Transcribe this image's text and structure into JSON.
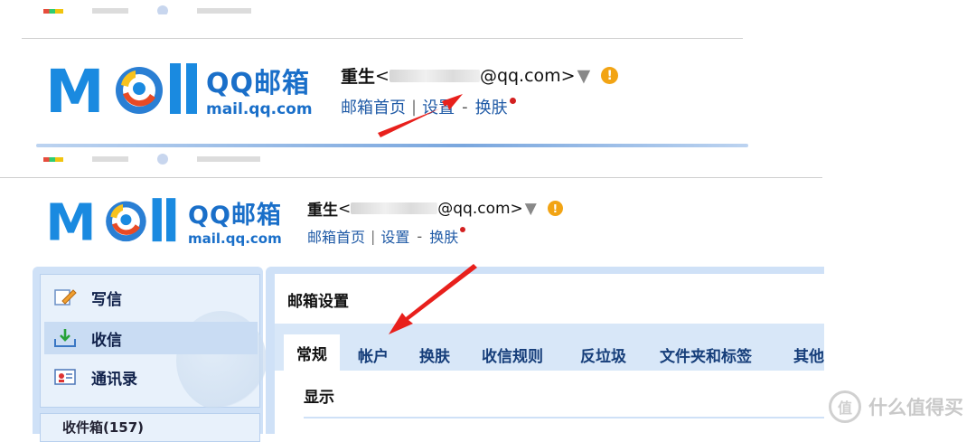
{
  "screens": [
    {
      "brand": {
        "cn": "QQ邮箱",
        "en": "mail.qq.com"
      },
      "user": {
        "name": "重生",
        "email_prefix": "<",
        "email_suffix": "@qq.com>",
        "caret": "▼",
        "warn": "!"
      },
      "links": {
        "home": "邮箱首页",
        "settings": "设置",
        "skin": "换肤"
      }
    },
    {
      "brand": {
        "cn": "QQ邮箱",
        "en": "mail.qq.com"
      },
      "user": {
        "name": "重生",
        "email_prefix": "<",
        "email_suffix": "@qq.com>",
        "caret": "▼",
        "warn": "!"
      },
      "links": {
        "home": "邮箱首页",
        "settings": "设置",
        "skin": "换肤"
      }
    }
  ],
  "sidebar": {
    "items": [
      {
        "label": "写信",
        "icon": "compose-icon"
      },
      {
        "label": "收信",
        "icon": "inbox-download-icon"
      },
      {
        "label": "通讯录",
        "icon": "contacts-card-icon"
      }
    ],
    "folder_label": "收件箱(157)"
  },
  "settings": {
    "title": "邮箱设置",
    "tabs": [
      "常规",
      "帐户",
      "换肤",
      "收信规则",
      "反垃圾",
      "文件夹和标签",
      "其他"
    ],
    "active_tab": "常规",
    "section": "显示"
  },
  "watermark": {
    "icon_glyph": "值",
    "text": "什么值得买"
  },
  "colors": {
    "brand_blue": "#1a6fc9",
    "link_blue": "#1f5aa6",
    "arrow_red": "#e8201c",
    "warn_orange": "#f2a414"
  }
}
